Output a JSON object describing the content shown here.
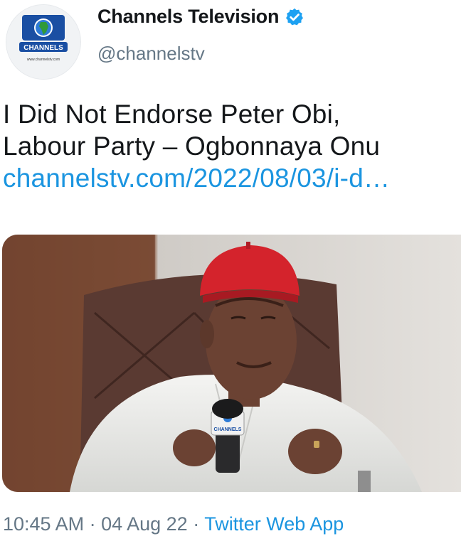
{
  "account": {
    "display_name": "Channels Television",
    "handle": "@channelstv",
    "verified": true,
    "avatar": {
      "brand_text": "CHANNELS",
      "site_text": "www.channelstv.com",
      "icon": "globe-africa-logo-icon"
    }
  },
  "tweet": {
    "text_lines": [
      "I Did Not Endorse Peter Obi,",
      "Labour Party – Ogbonnaya Onu"
    ],
    "link": "channelstv.com/2022/08/03/i-d…"
  },
  "media": {
    "description_icon": "photo-of-speaker-at-microphone",
    "mic_flag_text": "CHANNELS"
  },
  "meta": {
    "time": "10:45 AM",
    "date": "04 Aug 22",
    "separator": " · ",
    "source": "Twitter Web App"
  },
  "colors": {
    "link": "#1b95e0",
    "secondary": "#657786",
    "verified": "#1da1f2"
  }
}
